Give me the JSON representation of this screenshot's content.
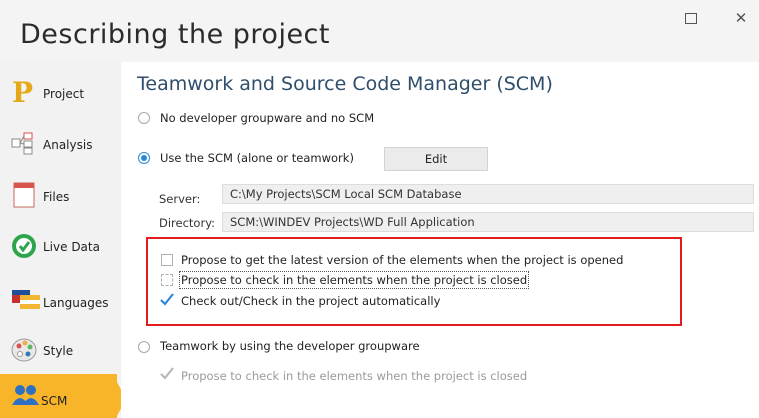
{
  "window": {
    "title": "Describing the project",
    "maximize_icon": "maximize-icon",
    "close_glyph": "✕"
  },
  "sidebar": {
    "items": [
      {
        "label": "Project",
        "icon": "project-icon"
      },
      {
        "label": "Analysis",
        "icon": "analysis-icon"
      },
      {
        "label": "Files",
        "icon": "files-icon"
      },
      {
        "label": "Live Data",
        "icon": "live-data-icon"
      },
      {
        "label": "Languages",
        "icon": "languages-icon"
      },
      {
        "label": "Style",
        "icon": "style-icon"
      },
      {
        "label": "SCM",
        "icon": "scm-icon",
        "active": true
      }
    ]
  },
  "main": {
    "heading": "Teamwork and Source Code Manager (SCM)",
    "options": {
      "no_scm": {
        "label": "No developer groupware and no SCM",
        "selected": false
      },
      "use_scm": {
        "label": "Use the SCM (alone or teamwork)",
        "selected": true
      },
      "groupware": {
        "label": "Teamwork by using the developer groupware",
        "selected": false
      }
    },
    "edit_button": "Edit",
    "server": {
      "label": "Server:",
      "value": "C:\\My Projects\\SCM Local SCM Database"
    },
    "directory": {
      "label": "Directory:",
      "value": "SCM:\\WINDEV Projects\\WD Full Application"
    },
    "checks": [
      {
        "label": "Propose to get the latest version of the elements when the project is opened",
        "checked": false
      },
      {
        "label": "Propose to check in the elements when the project is closed",
        "checked": false
      },
      {
        "label": "Check out/Check in the project automatically",
        "checked": true
      }
    ],
    "groupware_check": {
      "label": "Propose to check in the elements when the project is closed",
      "checked": true,
      "disabled": true
    }
  },
  "colors": {
    "accent": "#2d89d6",
    "active_nav": "#f9b52a",
    "highlight_border": "#e21b1b",
    "heading": "#2f4e6b"
  }
}
